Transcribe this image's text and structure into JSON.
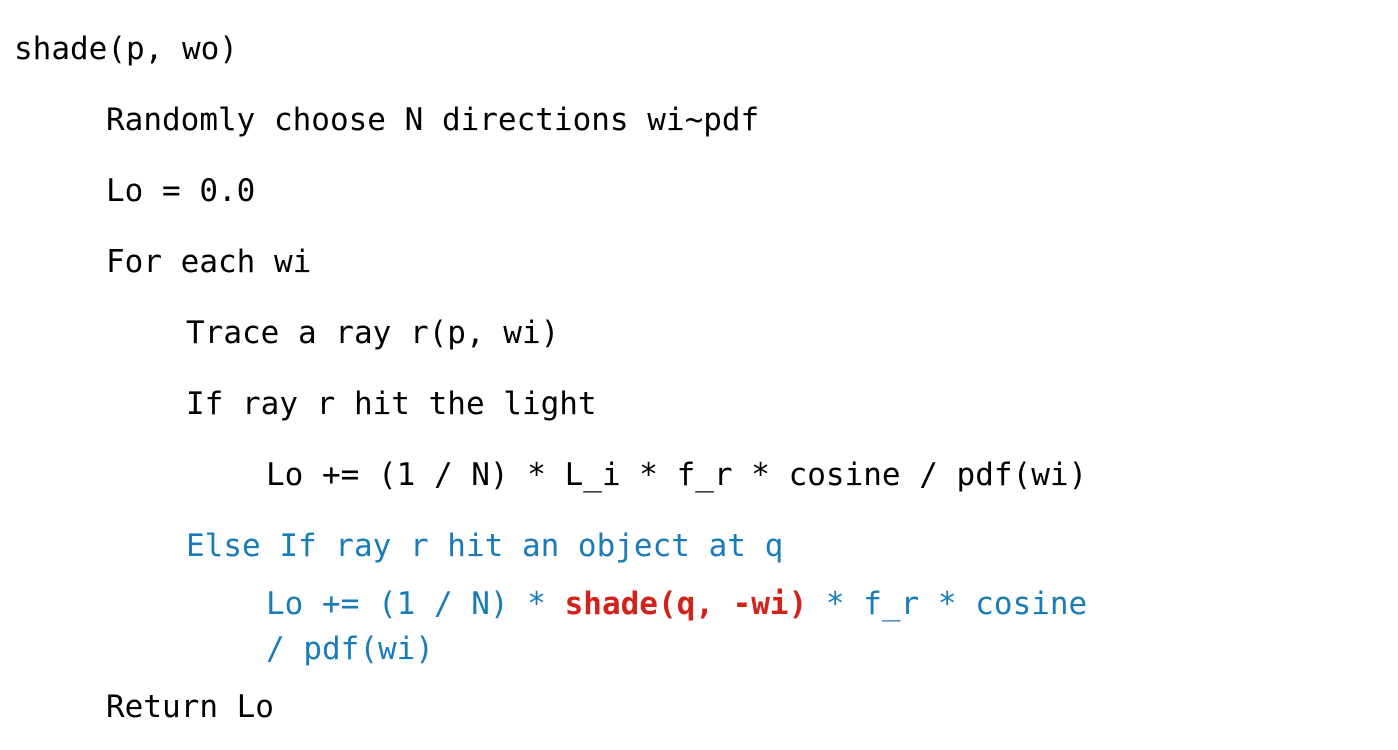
{
  "pseudocode": {
    "title": "shade(p, wo)",
    "lines": [
      {
        "indent": 0,
        "text": "shade(p, wo)",
        "color": "black"
      },
      {
        "indent": 1,
        "text": "Randomly choose N directions wi~pdf",
        "color": "black"
      },
      {
        "indent": 1,
        "text": "Lo = 0.0",
        "color": "black"
      },
      {
        "indent": 1,
        "text": "For each wi",
        "color": "black"
      },
      {
        "indent": 2,
        "text": "Trace a ray r(p, wi)",
        "color": "black"
      },
      {
        "indent": 2,
        "text": "If ray r hit the light",
        "color": "black"
      },
      {
        "indent": 3,
        "text": "Lo += (1 / N) * L_i * f_r * cosine / pdf(wi)",
        "color": "black"
      },
      {
        "indent": 2,
        "text": "Else If ray r hit an object at q",
        "color": "blue"
      },
      {
        "indent": 3,
        "color": "blue",
        "segments": [
          {
            "text": "Lo += (1 / N) * ",
            "style": "blue"
          },
          {
            "text": "shade(q, -wi)",
            "style": "red-bold"
          },
          {
            "text": " * f_r * cosine",
            "style": "blue"
          }
        ],
        "continuation": "/ pdf(wi)"
      },
      {
        "indent": 1,
        "text": "Return Lo",
        "color": "black"
      }
    ],
    "colors": {
      "default_text": "#000000",
      "highlight_blue": "#1a7bb9",
      "highlight_red": "#d1221b",
      "background": "#ffffff"
    }
  }
}
